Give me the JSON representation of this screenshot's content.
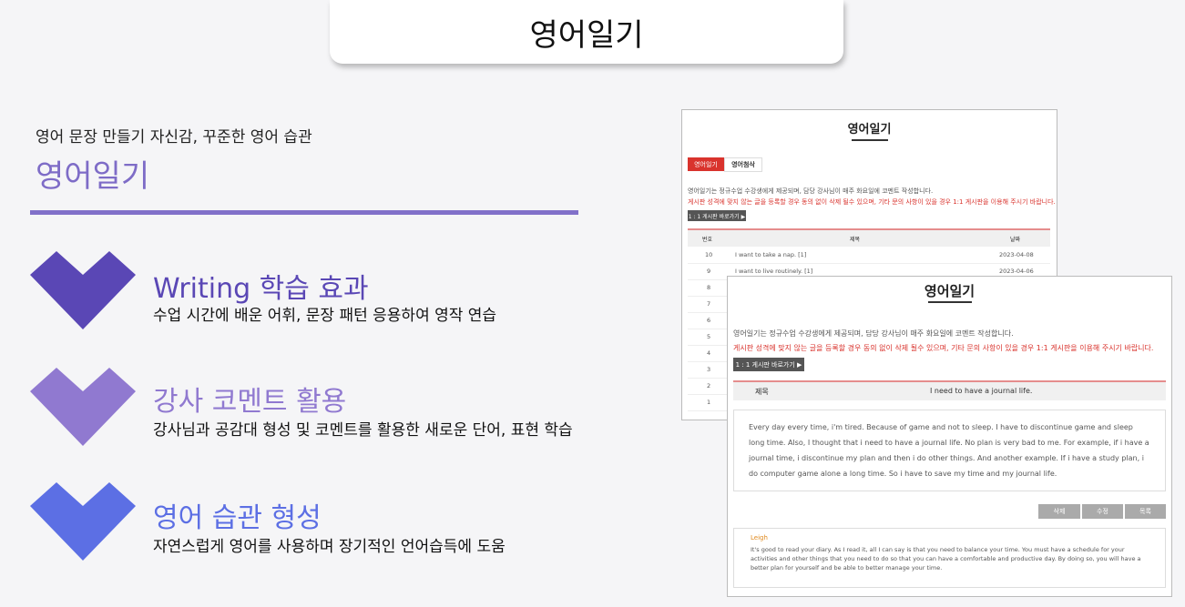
{
  "page": {
    "title": "영어일기"
  },
  "intro": {
    "subtitle": "영어 문장 만들기 자신감, 꾸준한 영어 습관",
    "title": "영어일기",
    "accent_color": "#8170c9"
  },
  "features": [
    {
      "heading": "Writing 학습 효과",
      "desc": "수업 시간에 배운 어휘, 문장 패턴 응용하여 영작 연습",
      "color": "#5a47b5",
      "icon": "chevron-down-icon"
    },
    {
      "heading": "강사 코멘트 활용",
      "desc": "강사님과 공감대 형성 및 코멘트를 활용한 새로운 단어, 표현 학습",
      "color": "#9079d0",
      "icon": "chevron-down-icon"
    },
    {
      "heading": "영어 습관 형성",
      "desc": "자연스럽게 영어를 사용하며 장기적인 언어습득에 도움",
      "color": "#5c6fe4",
      "icon": "chevron-down-icon"
    }
  ],
  "list_panel": {
    "title": "영어일기",
    "tabs": [
      {
        "label": "영어일기",
        "active": true
      },
      {
        "label": "영어첨삭",
        "active": false
      }
    ],
    "note1": "영어일기는 정규수업 수강생에게 제공되며, 담당 강사님이 매주 화요일에 코멘트 작성합니다.",
    "note2": "게시판 성격에 맞지 않는 글을 등록할 경우 동의 없이 삭제 될수 있으며, 기타 문의 사항이 있을 경우 1:1 게시판을 이용해 주시기 바랍니다.",
    "board_button": "1 : 1 게시판 바로가기 ▶",
    "columns": {
      "no": "번호",
      "title": "제목",
      "date": "날짜"
    },
    "rows": [
      {
        "no": "10",
        "title": "I want to take a nap. [1]",
        "date": "2023-04-08"
      },
      {
        "no": "9",
        "title": "I want to live routinely. [1]",
        "date": "2023-04-06"
      },
      {
        "no": "8",
        "title": "",
        "date": ""
      },
      {
        "no": "7",
        "title": "",
        "date": ""
      },
      {
        "no": "6",
        "title": "",
        "date": ""
      },
      {
        "no": "5",
        "title": "",
        "date": ""
      },
      {
        "no": "4",
        "title": "",
        "date": ""
      },
      {
        "no": "3",
        "title": "",
        "date": ""
      },
      {
        "no": "2",
        "title": "",
        "date": ""
      },
      {
        "no": "1",
        "title": "",
        "date": ""
      }
    ]
  },
  "detail_panel": {
    "title": "영어일기",
    "note1": "영어일기는 정규수업 수강생에게 제공되며, 담당 강사님이 매주 화요일에 코멘트 작성합니다.",
    "note2": "게시판 성격에 맞지 않는 글을 등록할 경우 동의 없이 삭제 될수 있으며, 기타 문의 사항이 있을 경우 1:1 게시판을 이용해 주시기 바랍니다.",
    "board_button": "1 : 1 게시판 바로가기 ▶",
    "subject_label": "제목",
    "subject": "I need to have a journal life.",
    "body": "Every day every time, i'm tired. Because of game and not to sleep. I have to discontinue game and sleep long time. Also, I thought that i need to have a journal life. No plan is very bad to me.  For example, if i have a journal time, i discontinue my plan and then i do other things. And another example. If i have a study plan, i do computer game alone a long time. So i have to save my time and my journal life.",
    "buttons": {
      "delete": "삭제",
      "edit": "수정",
      "list": "목록"
    },
    "comment_author": "Leigh",
    "comment": "It's good to read your diary. As I read it, all I can say is that you need to balance your time. You must have a schedule for your activities and other things that you need to do so that you can have a comfortable and productive day. By doing so, you will have a better plan for yourself and be able to better manage your time."
  }
}
